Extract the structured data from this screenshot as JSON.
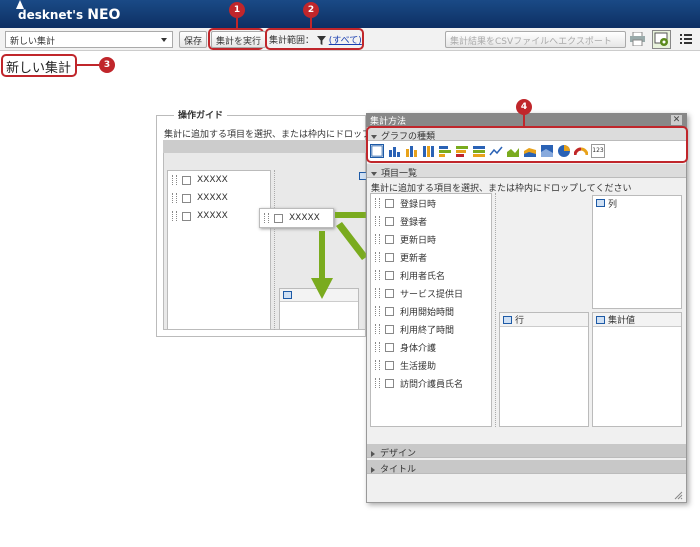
{
  "app": {
    "logo_main": "desknet's",
    "logo_sub": "NEO"
  },
  "toolbar": {
    "select_value": "新しい集計",
    "save_label": "保存",
    "run_label": "集計を実行",
    "range_label": "集計範囲：",
    "range_value": "(すべて)",
    "export_label": "集計結果をCSVファイルへエクスポート"
  },
  "callouts": [
    "1",
    "2",
    "3",
    "4"
  ],
  "page_title": "新しい集計",
  "guide": {
    "title": "操作ガイド",
    "instruction": "集計に追加する項目を選択、または枠内にドロップ",
    "items": [
      "XXXXX",
      "XXXXX",
      "XXXXX"
    ],
    "drag_item": "XXXXX"
  },
  "dialog": {
    "title": "集計方法",
    "graph_section": "グラフの種類",
    "items_section": "項目一覧",
    "instruction": "集計に追加する項目を選択、または枠内にドロップしてください",
    "fields": [
      "登録日時",
      "登録者",
      "更新日時",
      "更新者",
      "利用者氏名",
      "サービス提供日",
      "利用開始時間",
      "利用終了時間",
      "身体介護",
      "生活援助",
      "訪問介護員氏名"
    ],
    "col_label": "列",
    "row_label": "行",
    "value_label": "集計値",
    "design_section": "デザイン",
    "title_section": "タイトル",
    "num_icon": "123"
  },
  "colors": {
    "header": "#0d2f63",
    "callout": "#c0262b",
    "arrow": "#7aab1e"
  }
}
